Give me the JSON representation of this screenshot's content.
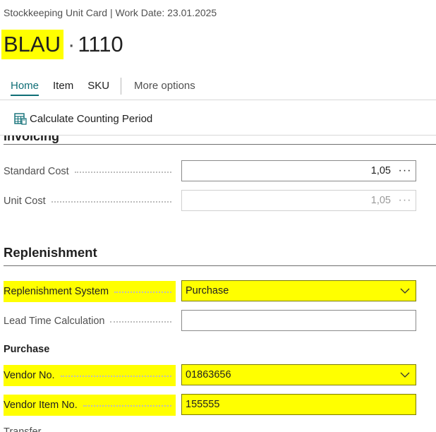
{
  "breadcrumb": "Stockkeeping Unit Card | Work Date: 23.01.2025",
  "title": {
    "key": "BLAU",
    "separator": "·",
    "number": "1110"
  },
  "tabs": [
    {
      "label": "Home",
      "active": true
    },
    {
      "label": "Item"
    },
    {
      "label": "SKU"
    },
    {
      "label": "More options"
    }
  ],
  "actions": {
    "calculate_counting_period": "Calculate Counting Period"
  },
  "invoicing": {
    "title": "Invoicing",
    "standard_cost": {
      "label": "Standard Cost",
      "value": "1,05"
    },
    "unit_cost": {
      "label": "Unit Cost",
      "value": "1,05"
    }
  },
  "replenishment": {
    "title": "Replenishment",
    "replenishment_system": {
      "label": "Replenishment System",
      "value": "Purchase"
    },
    "lead_time_calculation": {
      "label": "Lead Time Calculation",
      "value": ""
    },
    "purchase_group": "Purchase",
    "vendor_no": {
      "label": "Vendor No.",
      "value": "01863656"
    },
    "vendor_item_no": {
      "label": "Vendor Item No.",
      "value": "155555"
    }
  },
  "next_group": "Transfer",
  "colors": {
    "highlight": "#ffff00",
    "accent": "#0f6e76",
    "text": "#212121",
    "muted": "#505050"
  },
  "icons": {
    "action": "calculator-grid-icon",
    "more": "ellipsis-icon",
    "dropdown": "chevron-down-icon"
  }
}
